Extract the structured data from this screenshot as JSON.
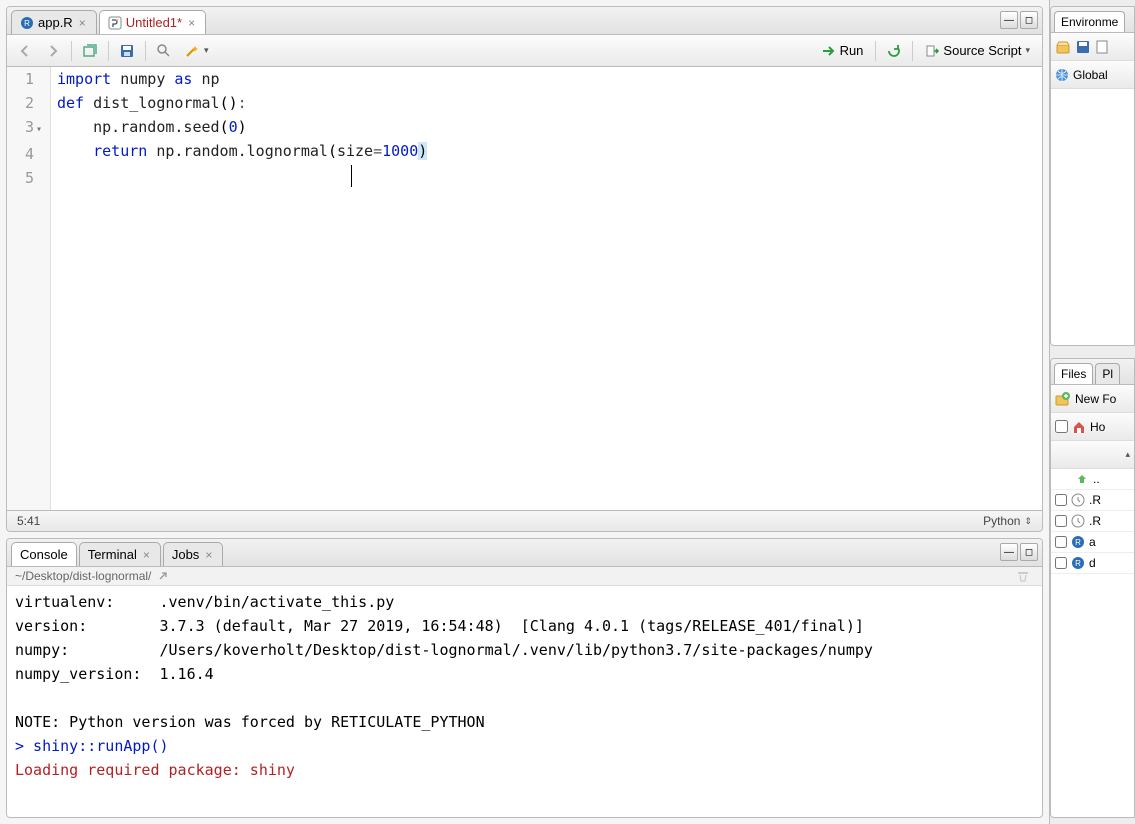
{
  "tabs": [
    {
      "label": "app.R",
      "active": false
    },
    {
      "label": "Untitled1*",
      "active": true
    }
  ],
  "toolbar": {
    "run_label": "Run",
    "source_label": "Source Script"
  },
  "code": {
    "lines": [
      {
        "n": "1",
        "tokens": [
          [
            "kw",
            "import"
          ],
          [
            "sp",
            " "
          ],
          [
            "fn",
            "numpy"
          ],
          [
            "sp",
            " "
          ],
          [
            "kw",
            "as"
          ],
          [
            "sp",
            " "
          ],
          [
            "fn",
            "np"
          ]
        ]
      },
      {
        "n": "2",
        "tokens": []
      },
      {
        "n": "3",
        "fold": true,
        "tokens": [
          [
            "kw",
            "def"
          ],
          [
            "sp",
            " "
          ],
          [
            "fn",
            "dist_lognormal"
          ],
          [
            "paren",
            "()"
          ],
          [
            "op",
            ":"
          ]
        ]
      },
      {
        "n": "4",
        "tokens": [
          [
            "sp",
            "    "
          ],
          [
            "fn",
            "np.random.seed"
          ],
          [
            "paren",
            "("
          ],
          [
            "num",
            "0"
          ],
          [
            "paren",
            ")"
          ]
        ]
      },
      {
        "n": "5",
        "tokens": [
          [
            "sp",
            "    "
          ],
          [
            "kw",
            "return"
          ],
          [
            "sp",
            " "
          ],
          [
            "fn",
            "np.random.lognormal"
          ],
          [
            "paren",
            "("
          ],
          [
            "fn",
            "size"
          ],
          [
            "op",
            "="
          ],
          [
            "num",
            "1000"
          ],
          [
            "paren-active",
            ")"
          ]
        ]
      }
    ]
  },
  "editor_status": {
    "position": "5:41",
    "language": "Python"
  },
  "console_tabs": [
    {
      "label": "Console",
      "active": true
    },
    {
      "label": "Terminal",
      "active": false,
      "closable": true
    },
    {
      "label": "Jobs",
      "active": false,
      "closable": true
    }
  ],
  "console_path": "~/Desktop/dist-lognormal/",
  "console_lines": [
    {
      "cls": "",
      "text": "virtualenv:     .venv/bin/activate_this.py"
    },
    {
      "cls": "",
      "text": "version:        3.7.3 (default, Mar 27 2019, 16:54:48)  [Clang 4.0.1 (tags/RELEASE_401/final)]"
    },
    {
      "cls": "",
      "text": "numpy:          /Users/koverholt/Desktop/dist-lognormal/.venv/lib/python3.7/site-packages/numpy"
    },
    {
      "cls": "",
      "text": "numpy_version:  1.16.4"
    },
    {
      "cls": "",
      "text": ""
    },
    {
      "cls": "",
      "text": "NOTE: Python version was forced by RETICULATE_PYTHON"
    },
    {
      "cls": "prompt",
      "text": "> shiny::runApp()"
    },
    {
      "cls": "err",
      "text": "Loading required package: shiny"
    }
  ],
  "env_panel": {
    "tab": "Environme",
    "scope": "Global"
  },
  "files_panel": {
    "tabs": [
      "Files",
      "Pl"
    ],
    "new_folder": "New Fo",
    "home_label": "Ho",
    "up_label": "..",
    "rows": [
      {
        "label": ".R",
        "icon": "history"
      },
      {
        "label": ".R",
        "icon": "history"
      },
      {
        "label": "a",
        "icon": "r"
      },
      {
        "label": "d",
        "icon": "r"
      }
    ]
  }
}
